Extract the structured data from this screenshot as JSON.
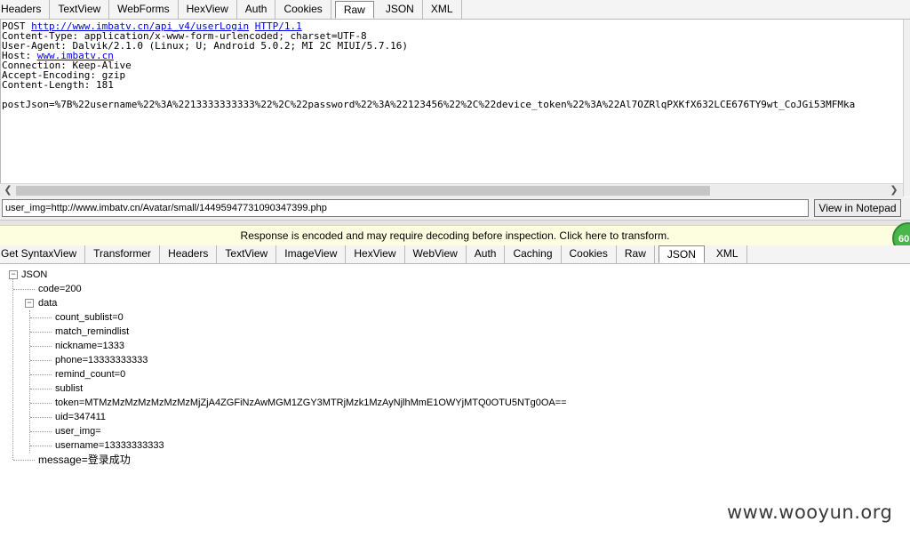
{
  "request_tabs": [
    "Headers",
    "TextView",
    "WebForms",
    "HexView",
    "Auth",
    "Cookies",
    "Raw",
    "JSON",
    "XML"
  ],
  "request_active_tab": "Raw",
  "raw_request": {
    "method": "POST",
    "url": "http://www.imbatv.cn/api_v4/userLogin",
    "protocol": "HTTP/1.1",
    "content_type": "Content-Type: application/x-www-form-urlencoded; charset=UTF-8",
    "user_agent": "User-Agent: Dalvik/2.1.0 (Linux; U; Android 5.0.2; MI 2C MIUI/5.7.16)",
    "host_label": "Host:",
    "host_value": "www.imbatv.cn",
    "connection": "Connection: Keep-Alive",
    "accept_encoding": "Accept-Encoding: gzip",
    "content_length": "Content-Length: 181",
    "body": "postJson=%7B%22username%22%3A%2213333333333%22%2C%22password%22%3A%22123456%22%2C%22device_token%22%3A%22Al7OZRlqPXKfX632LCE676TY9wt_CoJGi53MFMka"
  },
  "selected_value_field": "user_img=http://www.imbatv.cn/Avatar/small/14495947731090347399.php",
  "view_in_notepad_label": "View in Notepad",
  "notice_text": "Response is encoded and may require decoding before inspection. Click here to transform.",
  "badge_text": "60",
  "response_tabs": [
    "Get SyntaxView",
    "Transformer",
    "Headers",
    "TextView",
    "ImageView",
    "HexView",
    "WebView",
    "Auth",
    "Caching",
    "Cookies",
    "Raw",
    "JSON",
    "XML"
  ],
  "response_active_tab": "JSON",
  "tree": {
    "root": "JSON",
    "code": "code=200",
    "data": "data",
    "data_items": [
      "count_sublist=0",
      "match_remindlist",
      "nickname=1333",
      "phone=13333333333",
      "remind_count=0",
      "sublist",
      "token=MTMzMzMzMzMzMzMzMjZjA4ZGFiNzAwMGM1ZGY3MTRjMzk1MzAyNjlhMmE1OWYjMTQ0OTU5NTg0OA==",
      "uid=347411",
      "user_img=",
      "username=13333333333"
    ],
    "message": "message=登录成功"
  },
  "watermark": "www.wooyun.org",
  "icons": {
    "collapse": "minus-box-icon",
    "scroll_left": "chevron-left-icon",
    "scroll_right": "chevron-right-icon"
  }
}
